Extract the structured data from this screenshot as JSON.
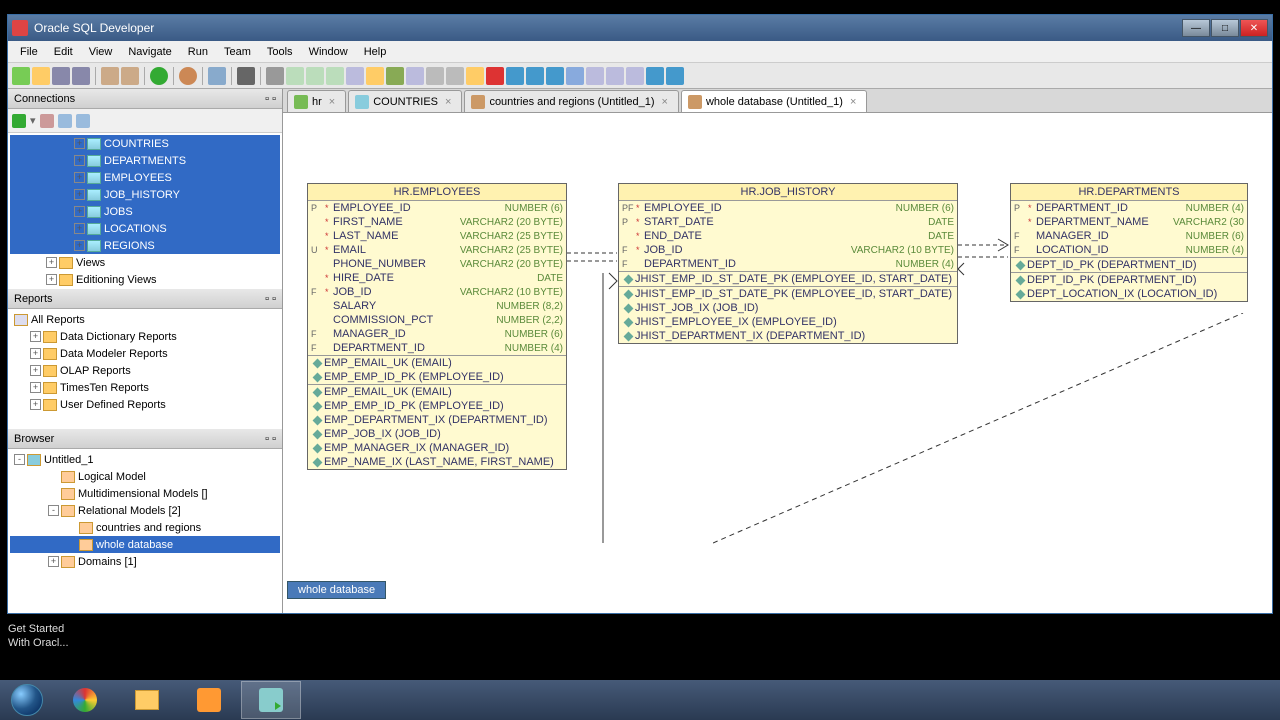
{
  "window": {
    "title": "Oracle SQL Developer"
  },
  "menu": [
    "File",
    "Edit",
    "View",
    "Navigate",
    "Run",
    "Team",
    "Tools",
    "Window",
    "Help"
  ],
  "panels": {
    "connections": "Connections",
    "reports": "Reports",
    "browser": "Browser"
  },
  "conn_tree": [
    {
      "label": "COUNTRIES",
      "sel": true
    },
    {
      "label": "DEPARTMENTS",
      "sel": true
    },
    {
      "label": "EMPLOYEES",
      "sel": true
    },
    {
      "label": "JOB_HISTORY",
      "sel": true
    },
    {
      "label": "JOBS",
      "sel": true
    },
    {
      "label": "LOCATIONS",
      "sel": true
    },
    {
      "label": "REGIONS",
      "sel": true
    }
  ],
  "conn_tree2": [
    {
      "label": "Views",
      "icon": "folder"
    },
    {
      "label": "Editioning Views",
      "icon": "folder"
    }
  ],
  "reports_tree": [
    "All Reports",
    "Data Dictionary Reports",
    "Data Modeler Reports",
    "OLAP Reports",
    "TimesTen Reports",
    "User Defined Reports"
  ],
  "browser_tree": {
    "root": "Untitled_1",
    "items": [
      {
        "label": "Logical Model",
        "indent": 1
      },
      {
        "label": "Multidimensional Models []",
        "indent": 1
      },
      {
        "label": "Relational Models [2]",
        "indent": 1,
        "exp": "-"
      },
      {
        "label": "countries and regions",
        "indent": 2
      },
      {
        "label": "whole database",
        "indent": 2,
        "sel": true
      },
      {
        "label": "Domains [1]",
        "indent": 1,
        "exp": "+"
      }
    ]
  },
  "tabs": [
    {
      "label": "hr",
      "icon": "#7b5"
    },
    {
      "label": "COUNTRIES",
      "icon": "#8cd"
    },
    {
      "label": "countries and regions (Untitled_1)",
      "icon": "#c96"
    },
    {
      "label": "whole database (Untitled_1)",
      "icon": "#c96",
      "active": true
    }
  ],
  "bottom_tab": "whole database",
  "entities": {
    "employees": {
      "title": "HR.EMPLOYEES",
      "cols": [
        {
          "f": "P",
          "s": "*",
          "n": "EMPLOYEE_ID",
          "t": "NUMBER (6)"
        },
        {
          "f": "",
          "s": "*",
          "n": "FIRST_NAME",
          "t": "VARCHAR2 (20 BYTE)"
        },
        {
          "f": "",
          "s": "*",
          "n": "LAST_NAME",
          "t": "VARCHAR2 (25 BYTE)"
        },
        {
          "f": "U",
          "s": "*",
          "n": "EMAIL",
          "t": "VARCHAR2 (25 BYTE)"
        },
        {
          "f": "",
          "s": "",
          "n": "PHONE_NUMBER",
          "t": "VARCHAR2 (20 BYTE)"
        },
        {
          "f": "",
          "s": "*",
          "n": "HIRE_DATE",
          "t": "DATE"
        },
        {
          "f": "F",
          "s": "*",
          "n": "JOB_ID",
          "t": "VARCHAR2 (10 BYTE)"
        },
        {
          "f": "",
          "s": "",
          "n": "SALARY",
          "t": "NUMBER (8,2)"
        },
        {
          "f": "",
          "s": "",
          "n": "COMMISSION_PCT",
          "t": "NUMBER (2,2)"
        },
        {
          "f": "F",
          "s": "",
          "n": "MANAGER_ID",
          "t": "NUMBER (6)"
        },
        {
          "f": "F",
          "s": "",
          "n": "DEPARTMENT_ID",
          "t": "NUMBER (4)"
        }
      ],
      "idx1": [
        "EMP_EMAIL_UK (EMAIL)",
        "EMP_EMP_ID_PK (EMPLOYEE_ID)"
      ],
      "idx2": [
        "EMP_EMAIL_UK (EMAIL)",
        "EMP_EMP_ID_PK (EMPLOYEE_ID)",
        "EMP_DEPARTMENT_IX (DEPARTMENT_ID)",
        "EMP_JOB_IX (JOB_ID)",
        "EMP_MANAGER_IX (MANAGER_ID)",
        "EMP_NAME_IX (LAST_NAME, FIRST_NAME)"
      ]
    },
    "jobhistory": {
      "title": "HR.JOB_HISTORY",
      "cols": [
        {
          "f": "PF",
          "s": "*",
          "n": "EMPLOYEE_ID",
          "t": "NUMBER (6)"
        },
        {
          "f": "P",
          "s": "*",
          "n": "START_DATE",
          "t": "DATE"
        },
        {
          "f": "",
          "s": "*",
          "n": "END_DATE",
          "t": "DATE"
        },
        {
          "f": "F",
          "s": "*",
          "n": "JOB_ID",
          "t": "VARCHAR2 (10 BYTE)"
        },
        {
          "f": "F",
          "s": "",
          "n": "DEPARTMENT_ID",
          "t": "NUMBER (4)"
        }
      ],
      "idx1": [
        "JHIST_EMP_ID_ST_DATE_PK (EMPLOYEE_ID, START_DATE)"
      ],
      "idx2": [
        "JHIST_EMP_ID_ST_DATE_PK (EMPLOYEE_ID, START_DATE)",
        "JHIST_JOB_IX (JOB_ID)",
        "JHIST_EMPLOYEE_IX (EMPLOYEE_ID)",
        "JHIST_DEPARTMENT_IX (DEPARTMENT_ID)"
      ]
    },
    "departments": {
      "title": "HR.DEPARTMENTS",
      "cols": [
        {
          "f": "P",
          "s": "*",
          "n": "DEPARTMENT_ID",
          "t": "NUMBER (4)"
        },
        {
          "f": "",
          "s": "*",
          "n": "DEPARTMENT_NAME",
          "t": "VARCHAR2 (30"
        },
        {
          "f": "F",
          "s": "",
          "n": "MANAGER_ID",
          "t": "NUMBER (6)"
        },
        {
          "f": "F",
          "s": "",
          "n": "LOCATION_ID",
          "t": "NUMBER (4)"
        }
      ],
      "idx1": [
        "DEPT_ID_PK (DEPARTMENT_ID)"
      ],
      "idx2": [
        "DEPT_ID_PK (DEPARTMENT_ID)",
        "DEPT_LOCATION_IX (LOCATION_ID)"
      ]
    }
  },
  "status": {
    "l1": "Get Started",
    "l2": "With Oracl..."
  }
}
